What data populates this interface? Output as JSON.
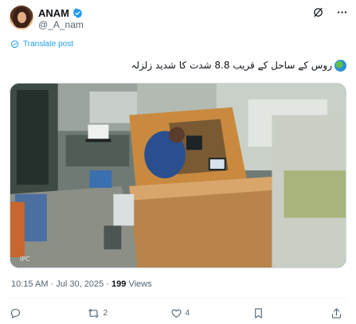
{
  "author": {
    "name": "ANAM",
    "handle": "@_A_nam",
    "verified": true
  },
  "header_icons": [
    "grok-icon",
    "more-icon"
  ],
  "translate_label": "Translate post",
  "tweet_text": "روس کے ساحل کے قریب 8.8 شدت کا شدید زلزلہ",
  "media": {
    "type": "video",
    "watermark": "IPC"
  },
  "meta": {
    "time": "10:15 AM",
    "separator": "·",
    "date": "Jul 30, 2025",
    "views_count": "199",
    "views_label": "Views"
  },
  "actions": {
    "reply_count": "",
    "retweet_count": "2",
    "like_count": "4",
    "bookmark_count": ""
  },
  "colors": {
    "accent": "#1d9bf0",
    "secondary_text": "#536471",
    "primary_text": "#0f1419"
  }
}
